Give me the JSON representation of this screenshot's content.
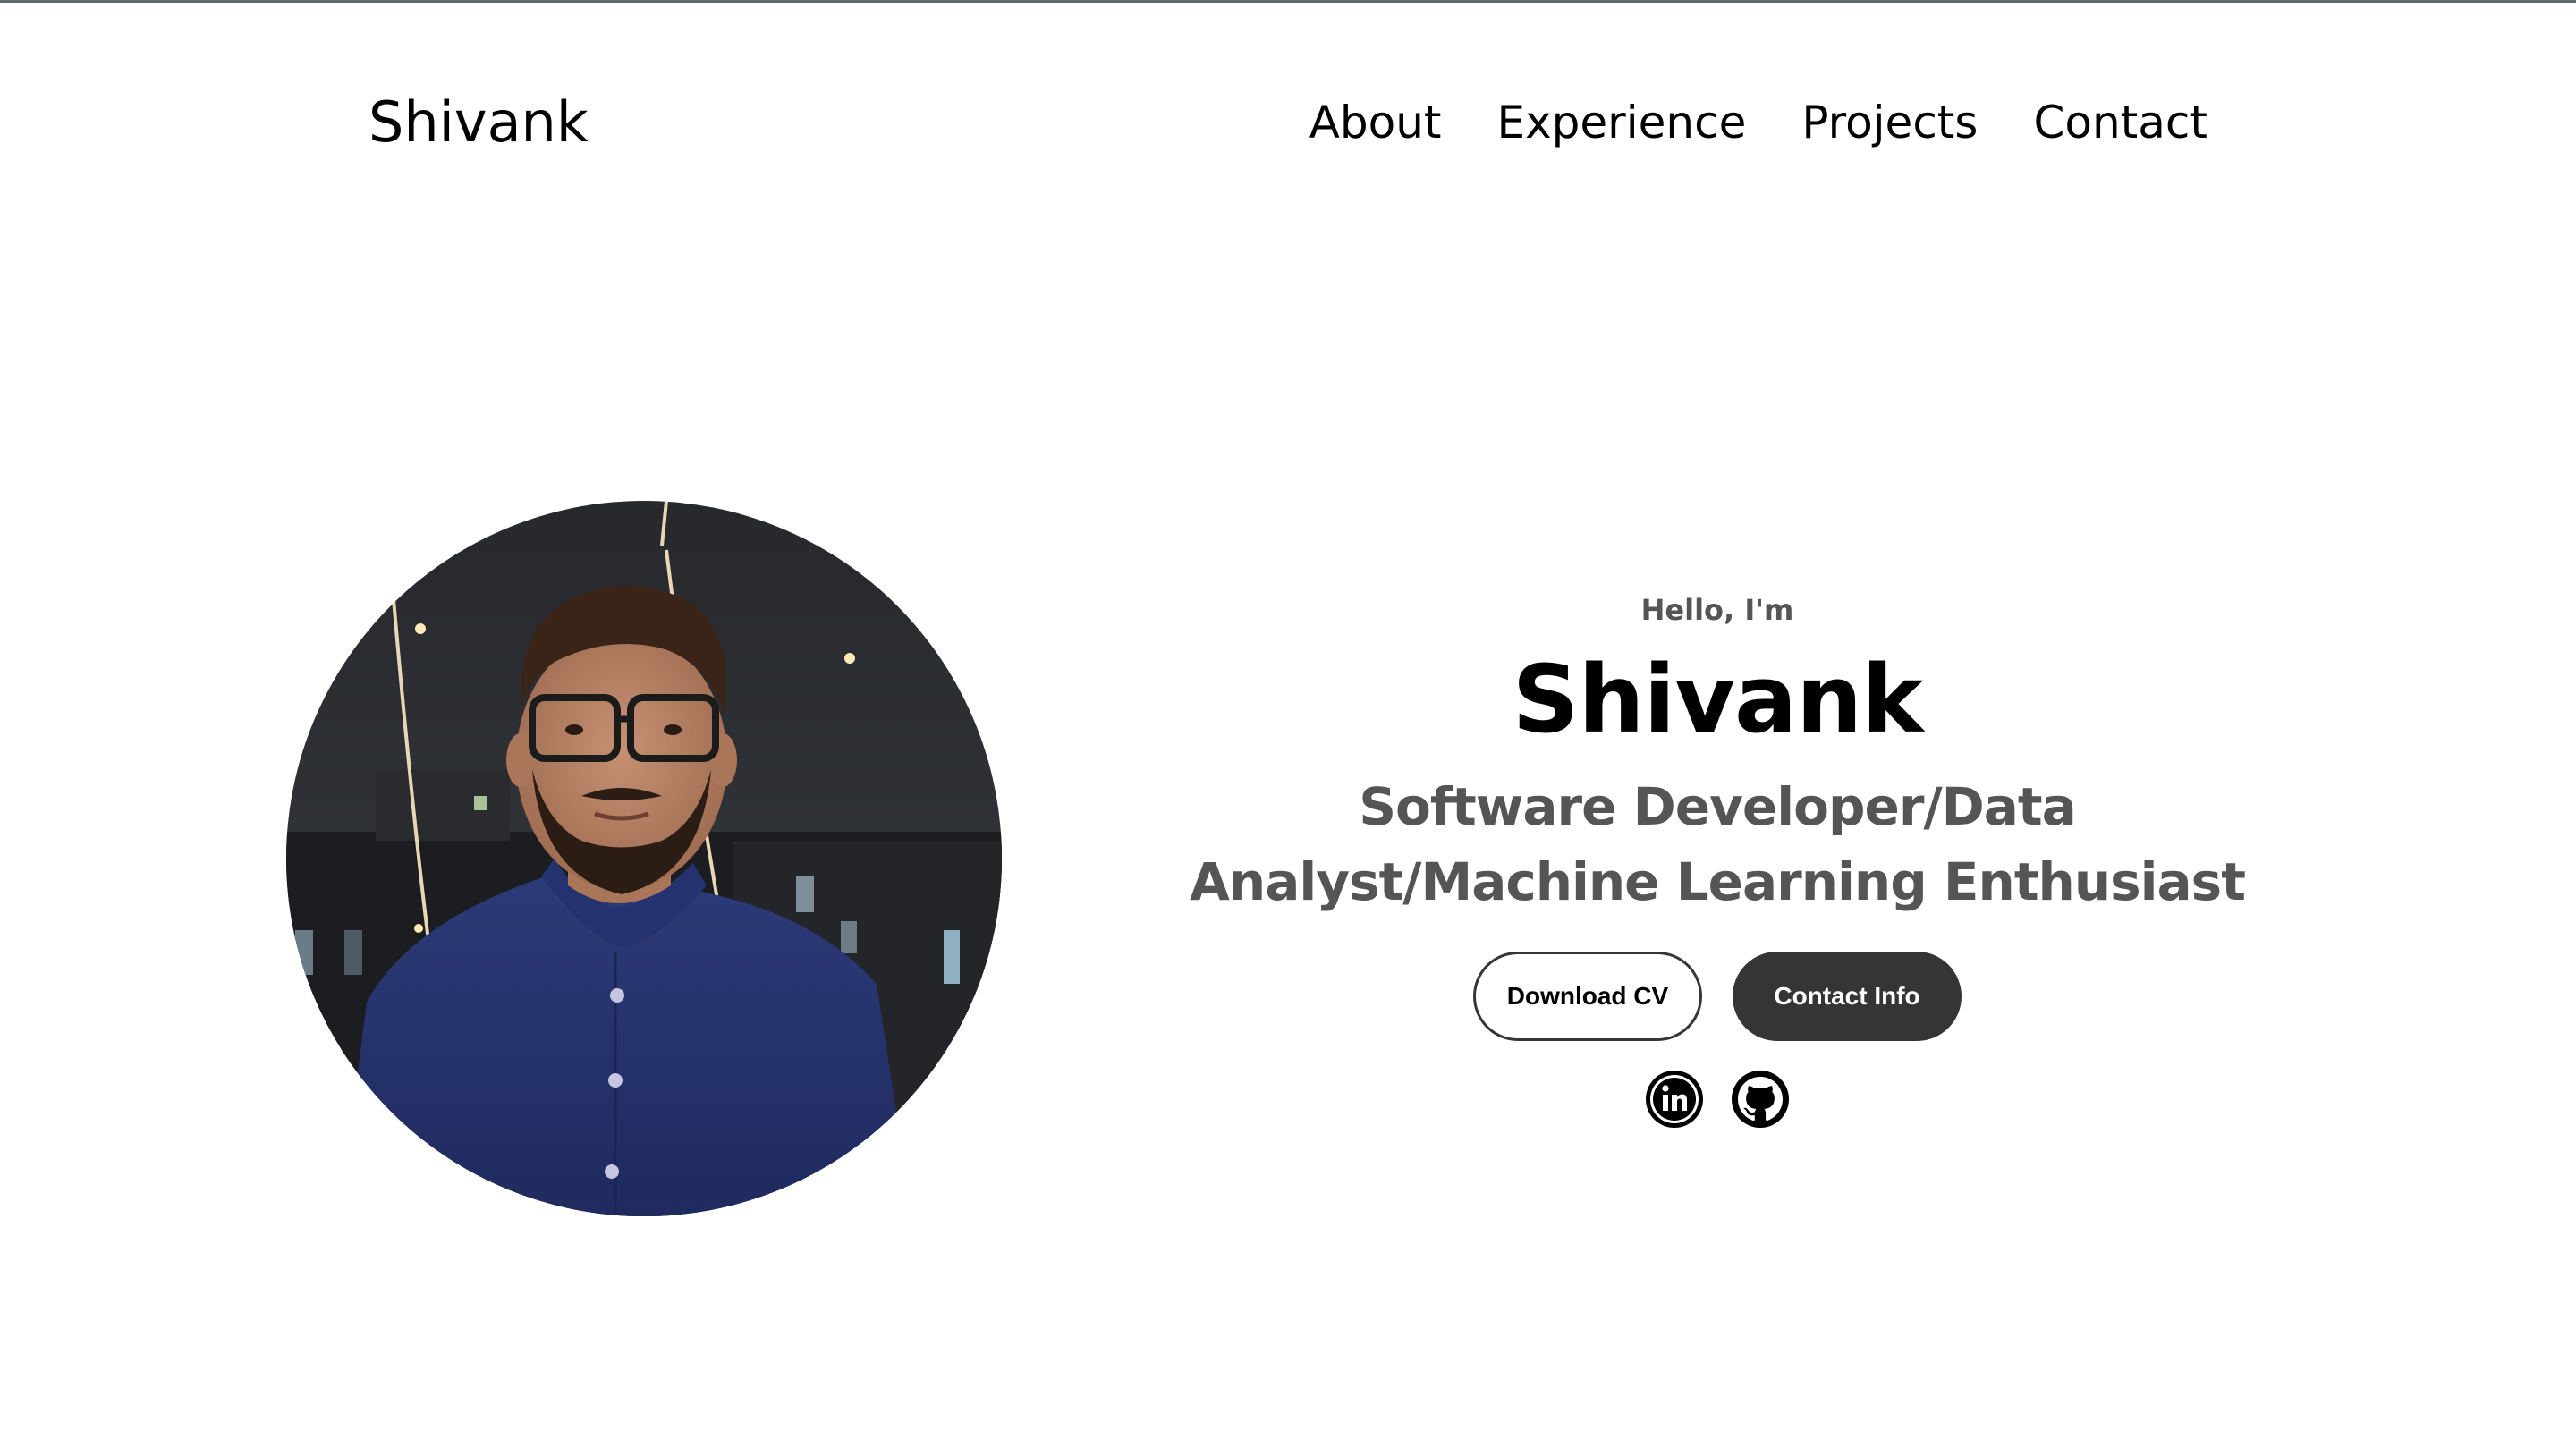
{
  "nav": {
    "logo": "Shivank",
    "links": [
      {
        "label": "About"
      },
      {
        "label": "Experience"
      },
      {
        "label": "Projects"
      },
      {
        "label": "Contact"
      }
    ]
  },
  "hero": {
    "greeting": "Hello, I'm",
    "name": "Shivank",
    "roles": "Software Developer/Data Analyst/Machine Learning Enthusiast",
    "buttons": {
      "download_cv": "Download CV",
      "contact_info": "Contact Info"
    },
    "social": [
      {
        "icon": "linkedin-icon"
      },
      {
        "icon": "github-icon"
      }
    ]
  },
  "colors": {
    "text_primary": "#000000",
    "text_secondary": "#555555",
    "button_dark": "#353535",
    "background": "#ffffff"
  }
}
